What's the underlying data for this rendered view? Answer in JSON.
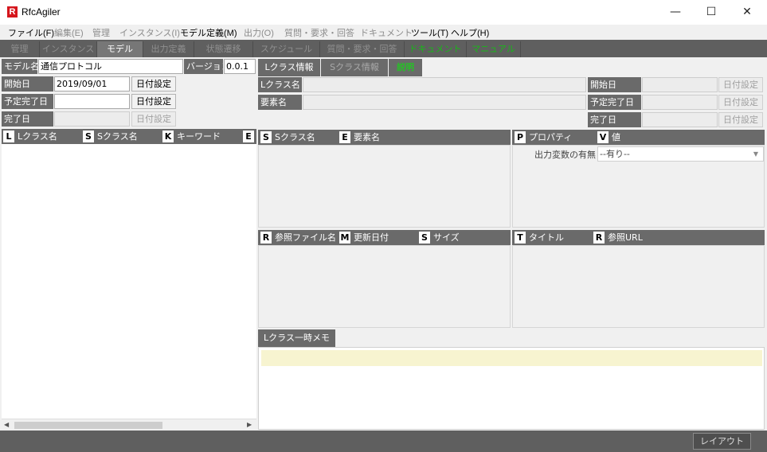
{
  "window": {
    "logo": "R",
    "title": "RfcAgiler",
    "minimize": "—",
    "maximize": "☐",
    "close": "✕"
  },
  "menu": [
    {
      "label": "ファイル(F)",
      "enabled": true
    },
    {
      "label": "編集(E)",
      "enabled": false
    },
    {
      "label": "管理",
      "enabled": false
    },
    {
      "label": "インスタンス(I)",
      "enabled": false
    },
    {
      "label": "モデル定義(M)",
      "enabled": true
    },
    {
      "label": "出力(O)",
      "enabled": false
    },
    {
      "label": "質問・要求・回答",
      "enabled": false
    },
    {
      "label": "ドキュメント",
      "enabled": false
    },
    {
      "label": "ツール(T)",
      "enabled": true
    },
    {
      "label": "ヘルプ(H)",
      "enabled": true
    }
  ],
  "tabs": [
    {
      "label": "管理"
    },
    {
      "label": "インスタンス"
    },
    {
      "label": "モデル"
    },
    {
      "label": "出力定義"
    },
    {
      "label": "状態遷移"
    },
    {
      "label": "スケジュール"
    },
    {
      "label": "質問・要求・回答"
    },
    {
      "label": "ドキュメント"
    },
    {
      "label": "マニュアル"
    }
  ],
  "model_form": {
    "model_name_label": "モデル名",
    "model_name_value": "通信プロトコル",
    "version_label": "バージョン",
    "version_value": "0.0.1",
    "start_date_label": "開始日",
    "start_date_value": "2019/09/01",
    "planned_end_label": "予定完了日",
    "planned_end_value": "",
    "end_date_label": "完了日",
    "end_date_value": "",
    "date_button": "日付設定"
  },
  "lclass_grid": {
    "headers": [
      {
        "key": "L",
        "label": "Lクラス名"
      },
      {
        "key": "S",
        "label": "Sクラス名"
      },
      {
        "key": "K",
        "label": "キーワード"
      },
      {
        "key": "E",
        "label": ""
      }
    ]
  },
  "right_tabs": [
    {
      "label": "Lクラス情報"
    },
    {
      "label": "Sクラス情報"
    },
    {
      "label": "説明"
    }
  ],
  "lclass_info": {
    "lclass_name_label": "Lクラス名",
    "element_name_label": "要素名",
    "start_date_label": "開始日",
    "planned_end_label": "予定完了日",
    "end_date_label": "完了日",
    "date_button": "日付設定"
  },
  "sclass_grid": {
    "headers": [
      {
        "key": "S",
        "label": "Sクラス名"
      },
      {
        "key": "E",
        "label": "要素名"
      }
    ]
  },
  "property_grid": {
    "headers": [
      {
        "key": "P",
        "label": "プロパティ"
      },
      {
        "key": "V",
        "label": "値"
      }
    ],
    "rows": [
      {
        "property": "出力変数の有無",
        "value": "--有り--"
      }
    ]
  },
  "ref_file_grid": {
    "headers": [
      {
        "key": "R",
        "label": "参照ファイル名"
      },
      {
        "key": "M",
        "label": "更新日付"
      },
      {
        "key": "S",
        "label": "サイズ"
      }
    ]
  },
  "ref_url_grid": {
    "headers": [
      {
        "key": "T",
        "label": "タイトル"
      },
      {
        "key": "R",
        "label": "参照URL"
      }
    ]
  },
  "memo": {
    "tab_label": "Lクラス一時メモ",
    "value": ""
  },
  "scrollbar": {
    "left_arrow": "◀",
    "right_arrow": "▶"
  },
  "status": {
    "layout_button": "レイアウト"
  }
}
